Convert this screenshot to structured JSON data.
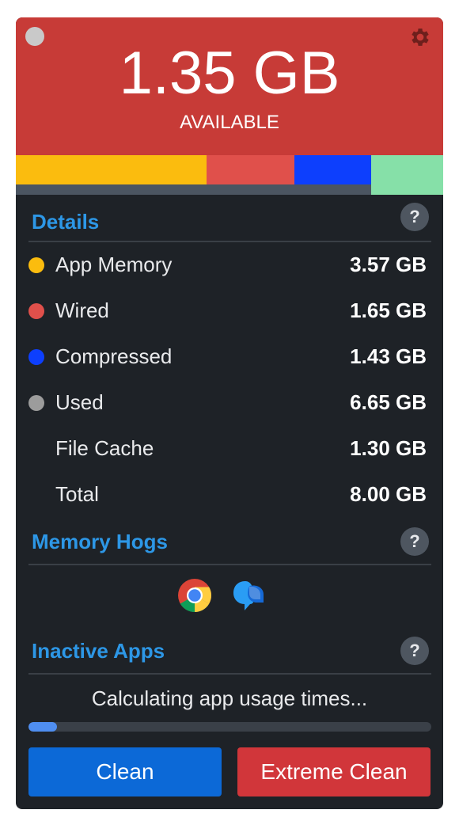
{
  "header": {
    "available_amount": "1.35 GB",
    "available_label": "AVAILABLE"
  },
  "memory_bar": {
    "segments": [
      {
        "name": "App Memory",
        "value_gb": 3.57,
        "color": "#fbbc0e"
      },
      {
        "name": "Wired",
        "value_gb": 1.65,
        "color": "#e0504b"
      },
      {
        "name": "Compressed",
        "value_gb": 1.43,
        "color": "#0d3ffd"
      },
      {
        "name": "Available",
        "value_gb": 1.35,
        "color": "#86e0a8"
      }
    ],
    "total_gb": 8.0
  },
  "details": {
    "title": "Details",
    "help": "?",
    "rows": [
      {
        "label": "App Memory",
        "value": "3.57 GB",
        "dot": "#fbbc0e"
      },
      {
        "label": "Wired",
        "value": "1.65 GB",
        "dot": "#e0504b"
      },
      {
        "label": "Compressed",
        "value": "1.43 GB",
        "dot": "#0d3ffd"
      },
      {
        "label": "Used",
        "value": "6.65 GB",
        "dot": "#9c9c9c"
      },
      {
        "label": "File Cache",
        "value": "1.30 GB",
        "dot": ""
      },
      {
        "label": "Total",
        "value": "8.00 GB",
        "dot": ""
      }
    ]
  },
  "memory_hogs": {
    "title": "Memory Hogs",
    "help": "?",
    "apps": [
      "chrome-icon",
      "messenger-icon"
    ]
  },
  "inactive_apps": {
    "title": "Inactive Apps",
    "help": "?",
    "status": "Calculating app usage times...",
    "progress": 0.07
  },
  "buttons": {
    "clean": "Clean",
    "extreme_clean": "Extreme Clean",
    "clean_color": "#0c69d7",
    "extreme_color": "#d1363a"
  },
  "colors": {
    "accent": "#2d97e6",
    "header": "#c73b37",
    "panel": "#1e2227"
  }
}
